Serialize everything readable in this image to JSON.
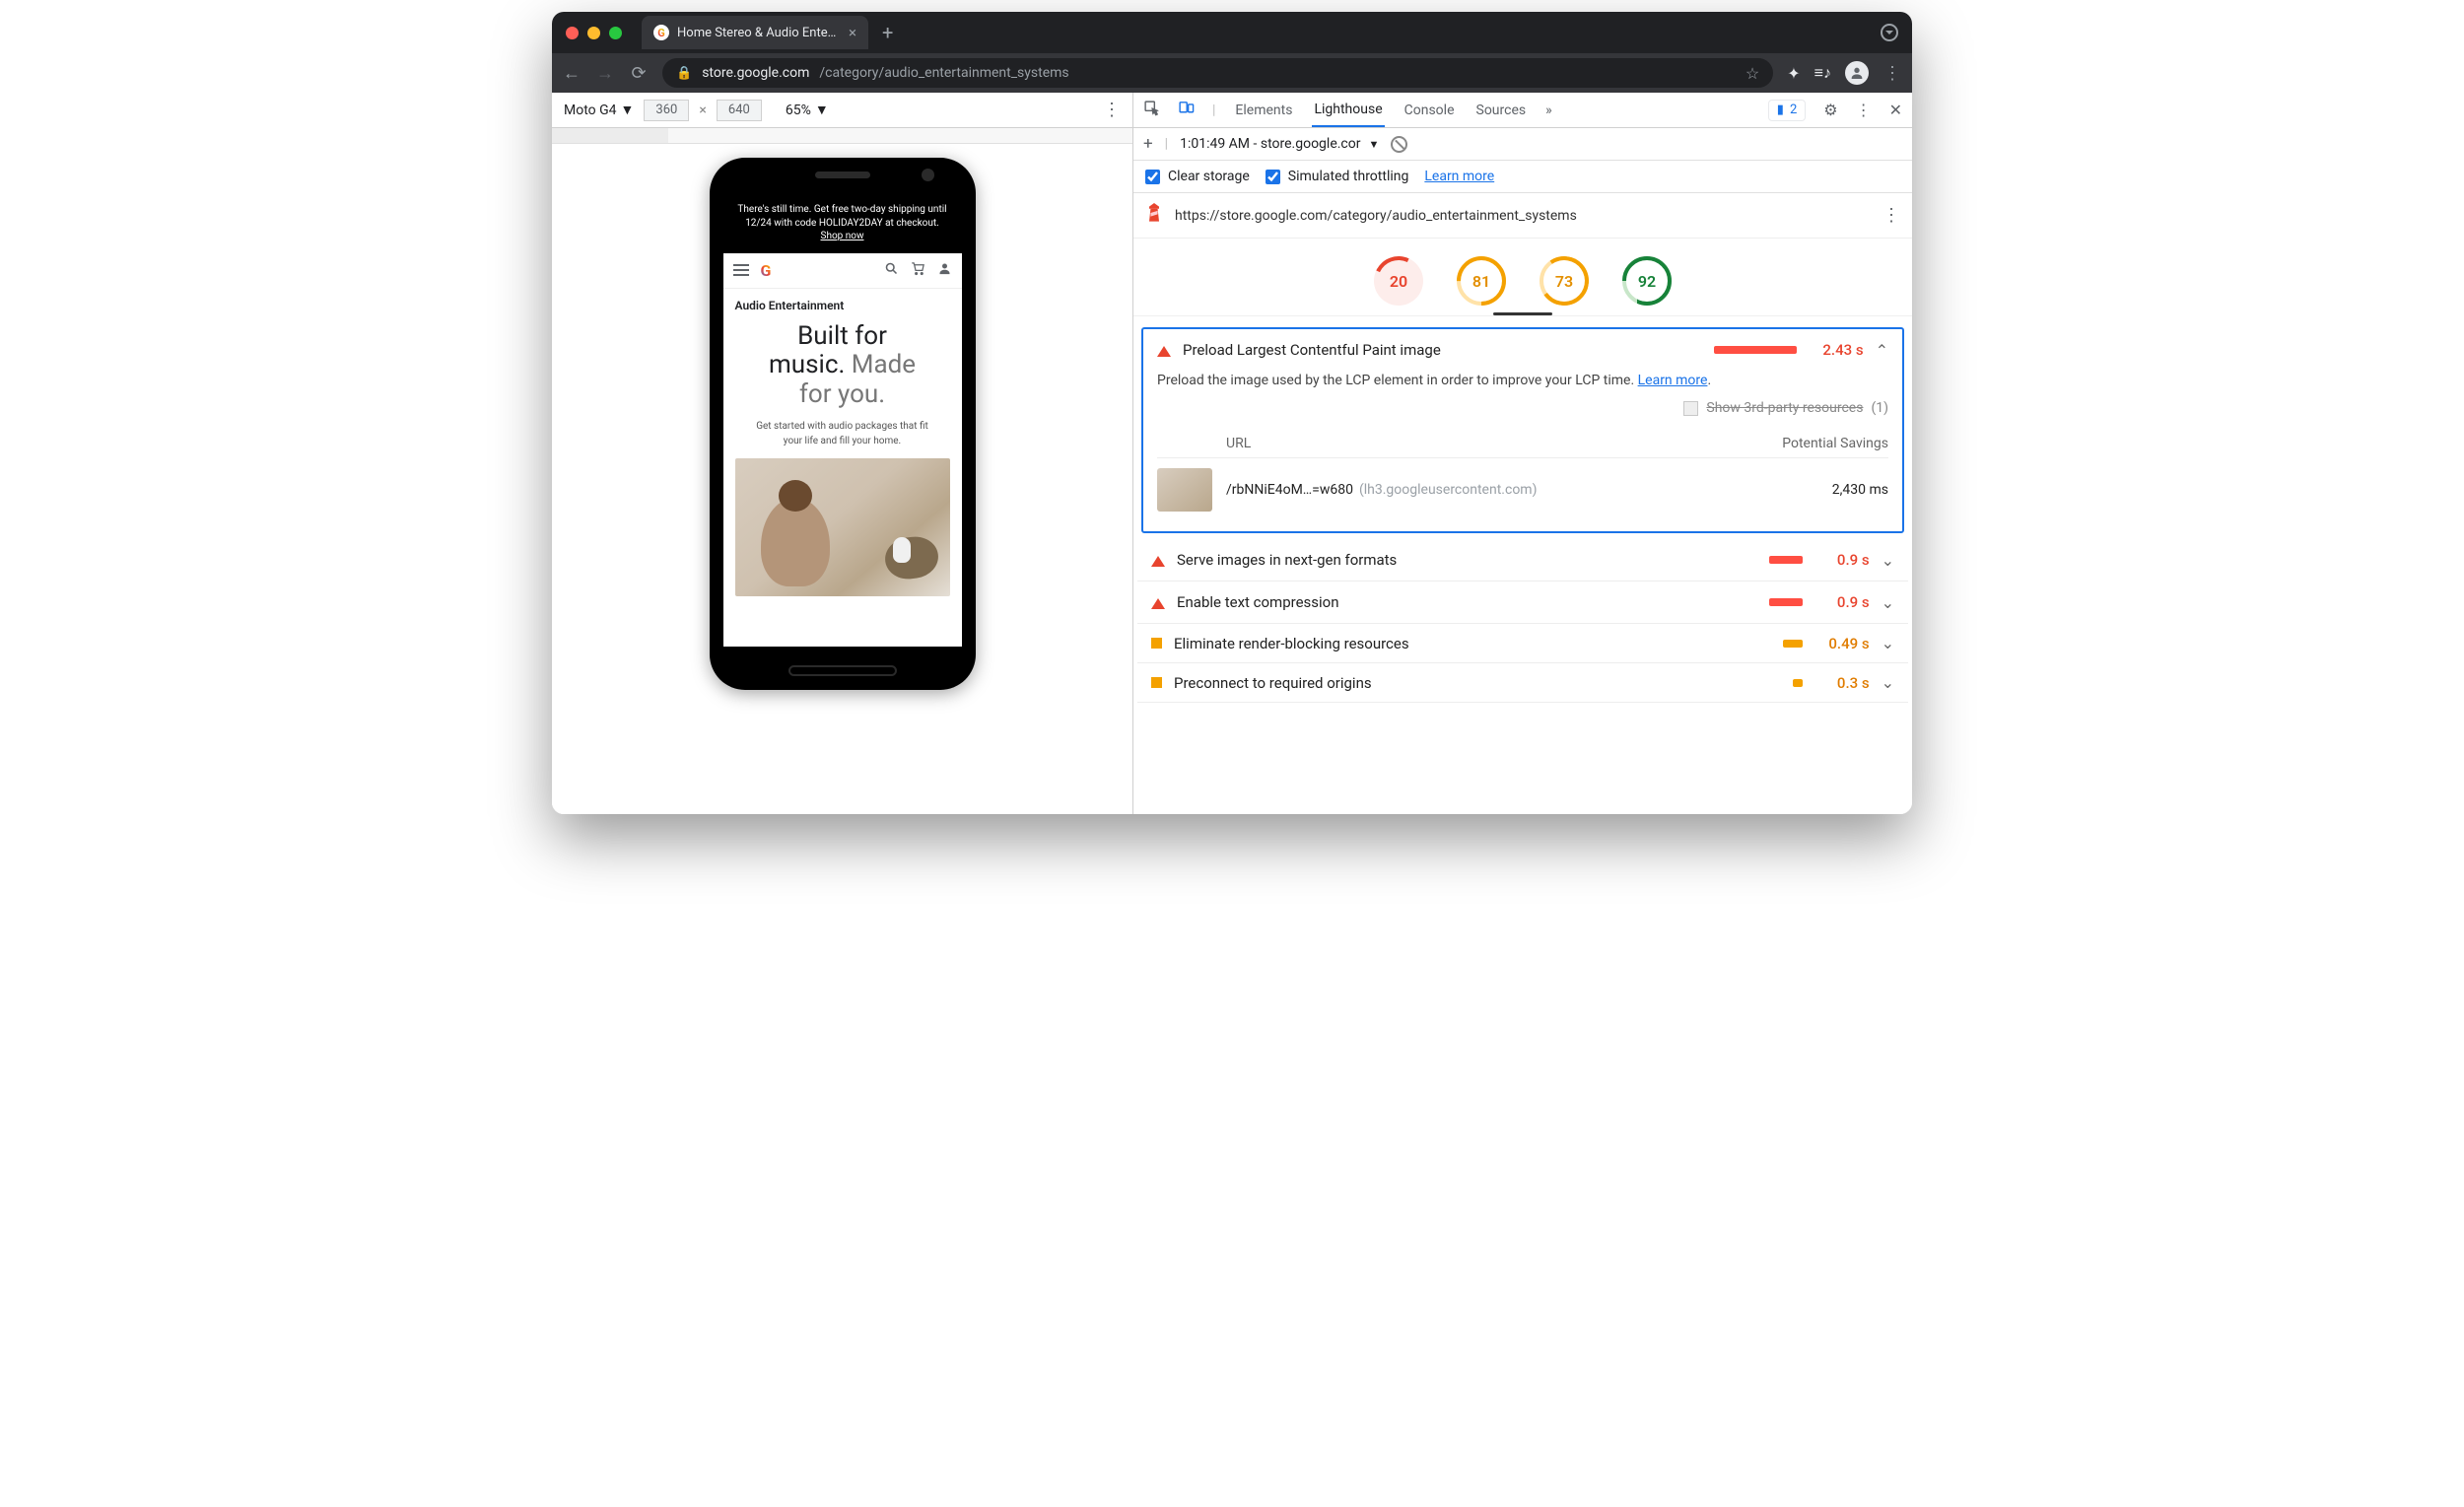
{
  "tab": {
    "title": "Home Stereo & Audio Entertain"
  },
  "url": {
    "domain": "store.google.com",
    "path": "/category/audio_entertainment_systems"
  },
  "deviceToolbar": {
    "device": "Moto G4",
    "width": "360",
    "height": "640",
    "zoom": "65%"
  },
  "phone": {
    "banner_pre": "There's still time. Get free two-day shipping until 12/24 with code HOLIDAY2DAY at checkout. ",
    "banner_link": "Shop now",
    "crumb": "Audio Entertainment",
    "hero1": "Built for",
    "hero2a": "music. ",
    "hero2b": "Made",
    "hero3": "for you.",
    "sub": "Get started with audio packages that fit your life and fill your home."
  },
  "devtools": {
    "tabs": {
      "elements": "Elements",
      "lighthouse": "Lighthouse",
      "console": "Console",
      "sources": "Sources"
    },
    "issues": "2",
    "runTime": "1:01:49 AM - store.google.cor",
    "clearStorage": "Clear storage",
    "throttling": "Simulated throttling",
    "learnMore": "Learn more",
    "auditUrl": "https://store.google.com/category/audio_entertainment_systems"
  },
  "scores": {
    "s1": "20",
    "s2": "81",
    "s3": "73",
    "s4": "92"
  },
  "open": {
    "title": "Preload Largest Contentful Paint image",
    "time": "2.43 s",
    "desc_a": "Preload the image used by the LCP element in order to improve your LCP time. ",
    "desc_link": "Learn more",
    "desc_b": ".",
    "thirdParty": "Show 3rd-party resources",
    "thirdPartyCount": "(1)",
    "col_url": "URL",
    "col_sav": "Potential Savings",
    "file": "/rbNNiE4oM…=w680",
    "file_host": "(lh3.googleusercontent.com)",
    "file_sav": "2,430 ms"
  },
  "rows": [
    {
      "title": "Serve images in next-gen formats",
      "time": "0.9 s",
      "sev": "tri",
      "barW": 34
    },
    {
      "title": "Enable text compression",
      "time": "0.9 s",
      "sev": "tri",
      "barW": 34
    },
    {
      "title": "Eliminate render-blocking resources",
      "time": "0.49 s",
      "sev": "sq",
      "barW": 20
    },
    {
      "title": "Preconnect to required origins",
      "time": "0.3 s",
      "sev": "sq",
      "barW": 10
    }
  ]
}
